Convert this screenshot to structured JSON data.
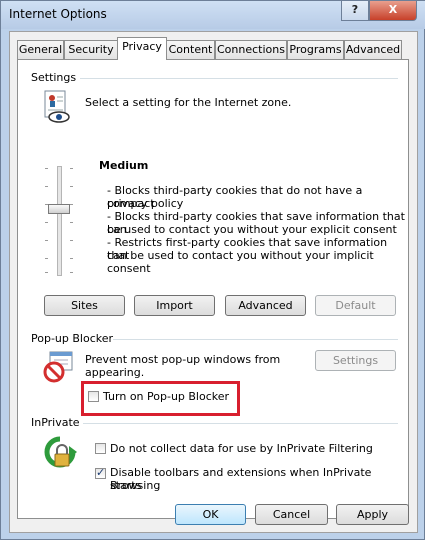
{
  "window": {
    "title": "Internet Options",
    "help_glyph": "?",
    "close_glyph": "X"
  },
  "tabs": [
    {
      "label": "General"
    },
    {
      "label": "Security"
    },
    {
      "label": "Privacy"
    },
    {
      "label": "Content"
    },
    {
      "label": "Connections"
    },
    {
      "label": "Programs"
    },
    {
      "label": "Advanced"
    }
  ],
  "settings": {
    "group_title": "Settings",
    "zone_prompt": "Select a setting for the Internet zone.",
    "level": "Medium",
    "descriptions": [
      "- Blocks third-party cookies that do not have a compact",
      "privacy policy",
      "- Blocks third-party cookies that save information that can",
      "be used to contact you without your explicit consent",
      "- Restricts first-party cookies that save information that",
      "can be used to contact you without your implicit consent"
    ],
    "buttons": {
      "sites": "Sites",
      "import": "Import",
      "advanced": "Advanced",
      "default": "Default"
    },
    "slider_level_fraction": 0.6
  },
  "popup": {
    "group_title": "Pop-up Blocker",
    "desc_line1": "Prevent most pop-up windows from",
    "desc_line2": "appearing.",
    "settings_button": "Settings",
    "toggle_label": "Turn on Pop-up Blocker",
    "toggle_checked": false
  },
  "inprivate": {
    "group_title": "InPrivate",
    "option1_label": "Do not collect data for use by InPrivate Filtering",
    "option1_checked": false,
    "option2_line1": "Disable toolbars and extensions when InPrivate Browsing",
    "option2_line2": "starts",
    "option2_checked": true
  },
  "footer": {
    "ok": "OK",
    "cancel": "Cancel",
    "apply": "Apply"
  },
  "colors": {
    "highlight": "#d81f2e",
    "title_bar": "#bcd1ea"
  },
  "icons": [
    "privacy-document-eye-icon",
    "popup-blocked-icon",
    "inprivate-lock-icon"
  ]
}
